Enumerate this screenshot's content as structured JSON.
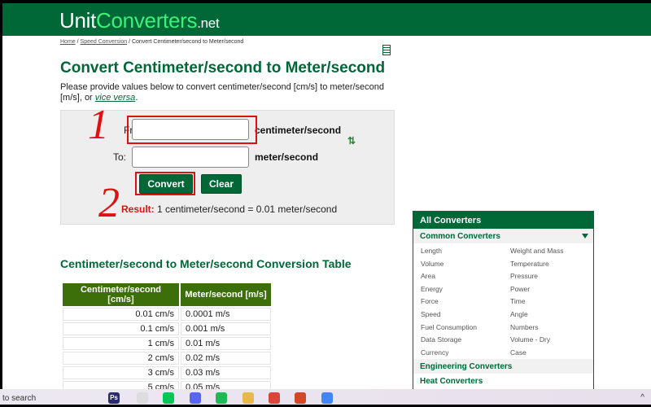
{
  "header": {
    "logo_unit": "Unit",
    "logo_converters": "Converters",
    "logo_net": ".net"
  },
  "breadcrumb": {
    "home": "Home",
    "sep1": " / ",
    "speed": "Speed Conversion",
    "sep2": " / ",
    "current": "Convert Centimeter/second to Meter/second"
  },
  "title": "Convert Centimeter/second to Meter/second",
  "description": {
    "text": "Please provide values below to convert centimeter/second [cm/s] to meter/second [m/s], or ",
    "link": "vice versa",
    "end": "."
  },
  "form": {
    "from_label": "From:",
    "from_value": "",
    "from_unit": "centimeter/second",
    "to_label": "To:",
    "to_value": "",
    "to_unit": "meter/second",
    "swap_icon": "swap-arrows",
    "convert": "Convert",
    "clear": "Clear",
    "result_label": "Result:",
    "result_text": " 1 centimeter/second = 0.01 meter/second"
  },
  "annotations": {
    "one": "1",
    "two": "2",
    "color": "#e01010"
  },
  "table": {
    "title": "Centimeter/second to Meter/second Conversion Table",
    "headers": [
      "Centimeter/second [cm/s]",
      "Meter/second [m/s]"
    ],
    "rows": [
      [
        "0.01 cm/s",
        "0.0001 m/s"
      ],
      [
        "0.1 cm/s",
        "0.001 m/s"
      ],
      [
        "1 cm/s",
        "0.01 m/s"
      ],
      [
        "2 cm/s",
        "0.02 m/s"
      ],
      [
        "3 cm/s",
        "0.03 m/s"
      ],
      [
        "5 cm/s",
        "0.05 m/s"
      ]
    ]
  },
  "sidebar": {
    "title": "All Converters",
    "common": "Common Converters",
    "items": [
      "Length",
      "Weight and Mass",
      "Volume",
      "Temperature",
      "Area",
      "Pressure",
      "Energy",
      "Power",
      "Force",
      "Time",
      "Speed",
      "Angle",
      "Fuel Consumption",
      "Numbers",
      "Data Storage",
      "Volume - Dry",
      "Currency",
      "Case"
    ],
    "engineering": "Engineering Converters",
    "heat": "Heat Converters"
  },
  "taskbar": {
    "search": "to search",
    "apps": [
      "Ps",
      "Apps",
      "LINE",
      "Discord",
      "Spotify",
      "Explorer",
      "Chrome",
      "PowerPoint",
      "Chrome"
    ]
  },
  "colors": {
    "brand": "#006837",
    "accent": "#3cf07a",
    "table_header": "#3c6e0a"
  }
}
